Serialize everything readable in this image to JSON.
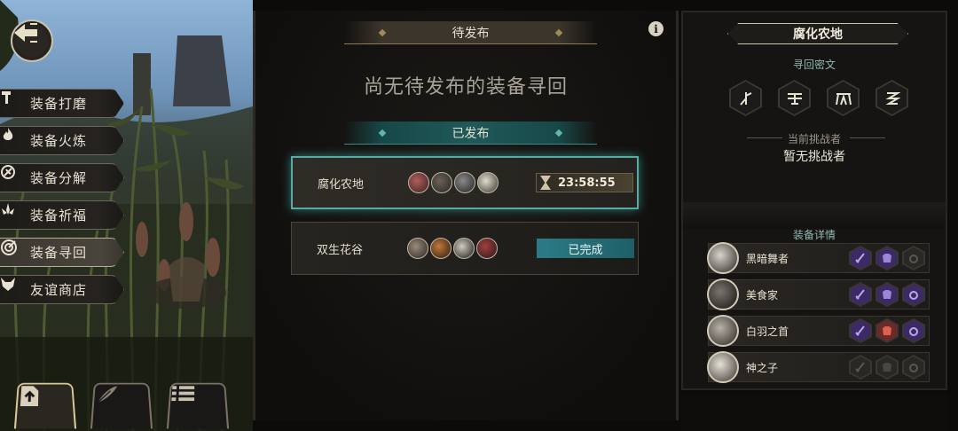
{
  "left_menu": {
    "items": [
      {
        "label": "装备打磨",
        "icon": "hammer-icon",
        "active": false
      },
      {
        "label": "装备火炼",
        "icon": "flame-icon",
        "active": false
      },
      {
        "label": "装备分解",
        "icon": "break-icon",
        "active": false
      },
      {
        "label": "装备祈福",
        "icon": "lotus-icon",
        "active": false
      },
      {
        "label": "装备寻回",
        "icon": "target-icon",
        "active": true
      },
      {
        "label": "友谊商店",
        "icon": "fox-icon",
        "active": false
      }
    ]
  },
  "bottom_tabs": [
    {
      "icon": "upload-icon",
      "active": true
    },
    {
      "icon": "feather-icon",
      "active": false
    },
    {
      "icon": "list-icon",
      "active": false
    }
  ],
  "middle": {
    "pending_header": "待发布",
    "empty_message": "尚无待发布的装备寻回",
    "published_header": "已发布",
    "quests": [
      {
        "name": "腐化农地",
        "timer": "23:58:55",
        "status": null,
        "selected": true
      },
      {
        "name": "双生花谷",
        "timer": null,
        "status": "已完成",
        "selected": false
      }
    ]
  },
  "right": {
    "location_title": "腐化农地",
    "runes_header": "寻回密文",
    "runes": [
      "rune-1-icon",
      "rune-2-icon",
      "rune-3-icon",
      "rune-4-icon"
    ],
    "challenger_label": "当前挑战者",
    "challenger_value": "暂无挑战者",
    "equip_header": "装备详情",
    "equipment": [
      {
        "name": "黑暗舞者",
        "slots": [
          "purple",
          "purple",
          "empty"
        ]
      },
      {
        "name": "美食家",
        "slots": [
          "purple",
          "purple",
          "purple"
        ]
      },
      {
        "name": "白羽之首",
        "slots": [
          "purple",
          "red",
          "purple"
        ]
      },
      {
        "name": "神之子",
        "slots": [
          "empty",
          "empty",
          "empty"
        ]
      }
    ]
  },
  "colors": {
    "accent_teal": "#2b7b86",
    "equip_purple": "#3c2a66",
    "equip_red": "#6b2a26"
  }
}
